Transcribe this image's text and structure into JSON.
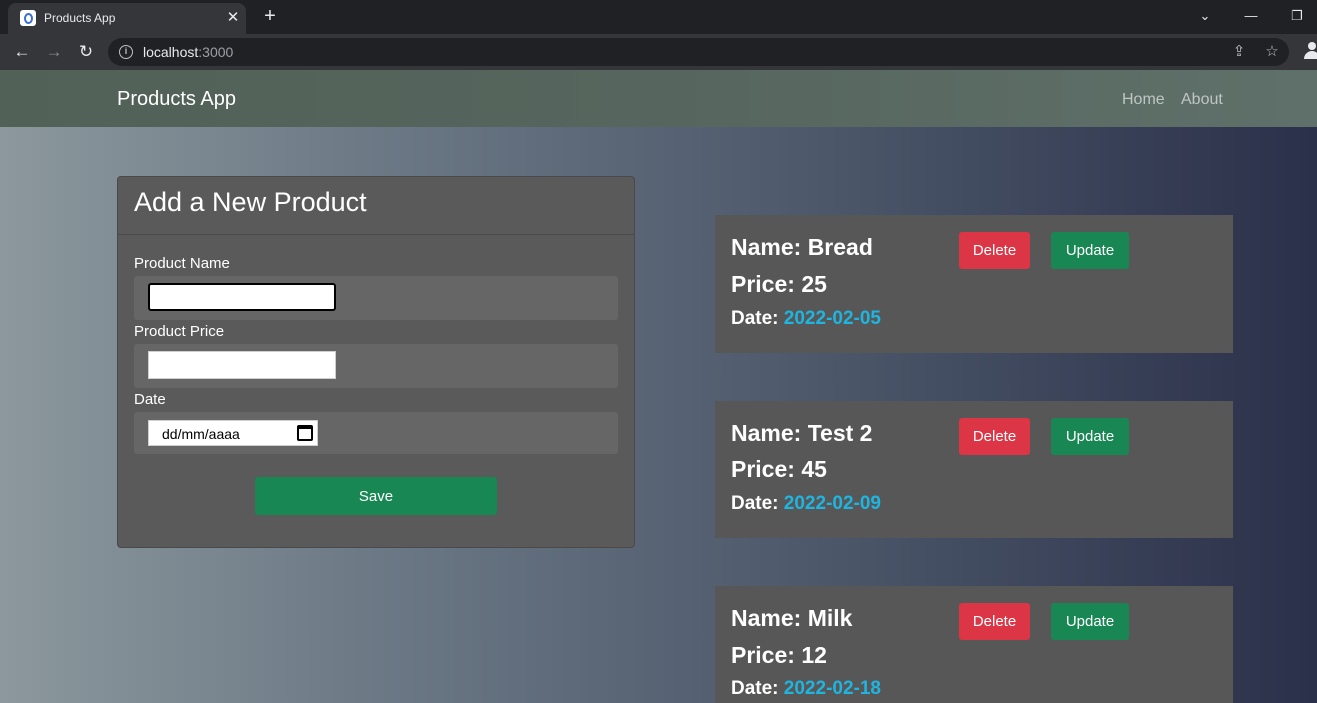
{
  "browser": {
    "tab_title": "Products App",
    "url_host": "localhost",
    "url_port": ":3000"
  },
  "navbar": {
    "brand": "Products App",
    "links": [
      "Home",
      "About"
    ]
  },
  "form": {
    "title": "Add a New Product",
    "name_label": "Product Name",
    "name_value": "",
    "price_label": "Product Price",
    "price_value": "",
    "date_label": "Date",
    "date_placeholder": "dd/mm/aaaa",
    "save_label": "Save"
  },
  "products": [
    {
      "name": "Name: Bread",
      "price": "Price: 25",
      "date_label": "Date: ",
      "date": "2022-02-05"
    },
    {
      "name": "Name: Test 2",
      "price": "Price: 45",
      "date_label": "Date: ",
      "date": "2022-02-09"
    },
    {
      "name": "Name: Milk",
      "price": "Price: 12",
      "date_label": "Date: ",
      "date": "2022-02-18"
    }
  ],
  "actions": {
    "delete_label": "Delete",
    "update_label": "Update"
  },
  "colors": {
    "delete": "#dc3545",
    "update": "#198754",
    "save": "#198754",
    "date_accent": "#1fb5e0"
  }
}
